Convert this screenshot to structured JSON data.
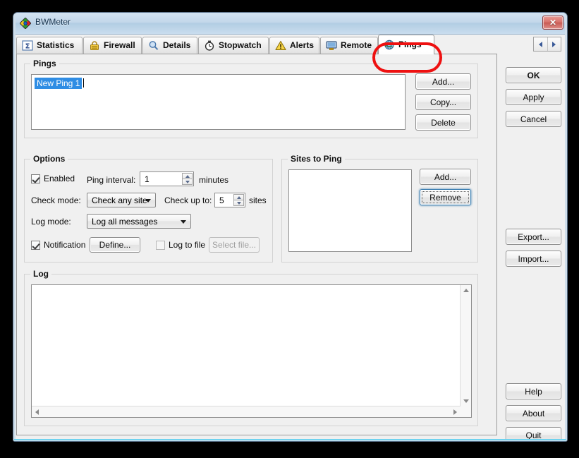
{
  "window": {
    "title": "BWMeter",
    "app_icon": "bwmeter-diamond-icon",
    "close_label": "✕"
  },
  "tabs": [
    {
      "label": "Statistics",
      "icon": "sigma-icon",
      "active": false
    },
    {
      "label": "Firewall",
      "icon": "lock-icon",
      "active": false
    },
    {
      "label": "Details",
      "icon": "magnifier-icon",
      "active": false
    },
    {
      "label": "Stopwatch",
      "icon": "stopwatch-icon",
      "active": false
    },
    {
      "label": "Alerts",
      "icon": "warning-icon",
      "active": false
    },
    {
      "label": "Remote",
      "icon": "monitor-icon",
      "active": false
    },
    {
      "label": "Pings",
      "icon": "globe-icon",
      "active": true
    }
  ],
  "tab_nav": {
    "prev": "left-arrow-icon",
    "next": "right-arrow-icon"
  },
  "pings_group": {
    "legend": "Pings",
    "items": [
      {
        "label": "New Ping 1",
        "selected": true,
        "editing": true
      }
    ],
    "buttons": [
      {
        "label": "Add...",
        "name": "add-ping-button"
      },
      {
        "label": "Copy...",
        "name": "copy-ping-button"
      },
      {
        "label": "Delete",
        "name": "delete-ping-button"
      }
    ]
  },
  "options_group": {
    "legend": "Options",
    "enabled": {
      "label": "Enabled",
      "checked": true
    },
    "ping_interval": {
      "label": "Ping interval:",
      "value": "1",
      "unit": "minutes"
    },
    "check_mode": {
      "label": "Check mode:",
      "value": "Check any site"
    },
    "check_up_to": {
      "label": "Check up to:",
      "value": "5",
      "unit": "sites"
    },
    "log_mode": {
      "label": "Log mode:",
      "value": "Log all messages"
    },
    "notification": {
      "label": "Notification",
      "checked": true
    },
    "define_button": "Define...",
    "log_to_file": {
      "label": "Log to file",
      "checked": false
    },
    "select_file_button": "Select file..."
  },
  "sites_group": {
    "legend": "Sites to Ping",
    "items": [],
    "buttons": [
      {
        "label": "Add...",
        "name": "add-site-button",
        "focused": false
      },
      {
        "label": "Remove",
        "name": "remove-site-button",
        "focused": true
      }
    ]
  },
  "log_group": {
    "legend": "Log",
    "text": ""
  },
  "rail_buttons": [
    {
      "label": "OK",
      "name": "ok-button",
      "bold": true
    },
    {
      "label": "Apply",
      "name": "apply-button",
      "bold": false
    },
    {
      "label": "Cancel",
      "name": "cancel-button",
      "bold": false
    },
    {
      "label": "Export...",
      "name": "export-button",
      "bold": false
    },
    {
      "label": "Import...",
      "name": "import-button",
      "bold": false
    },
    {
      "label": "Help",
      "name": "help-button",
      "bold": false
    },
    {
      "label": "About",
      "name": "about-button",
      "bold": false
    },
    {
      "label": "Quit",
      "name": "quit-button",
      "bold": false
    }
  ],
  "annotation": {
    "type": "red-rounded-rect-highlight",
    "color": "#ee1111",
    "target": "Pings"
  },
  "colors": {
    "selection_blue": "#2f8de4",
    "title_blue": "#c3d7ea",
    "dialog_gray": "#f0f0f0",
    "focus_blue": "#3c7fb1",
    "annotation_red": "#ee1111"
  }
}
